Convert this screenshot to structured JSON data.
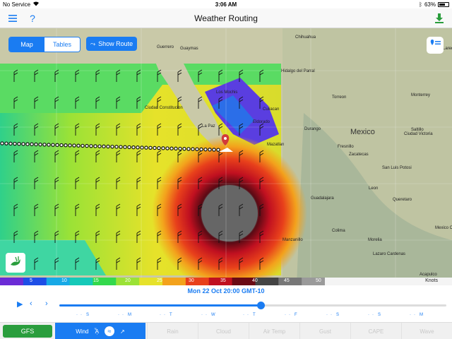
{
  "status_bar": {
    "carrier": "No Service",
    "time": "3:06 AM",
    "battery_label": "63%",
    "battery_level": 0.63
  },
  "nav": {
    "title": "Weather Routing",
    "menu_icon": "hamburger-icon",
    "help_label": "?",
    "download_icon": "download-icon"
  },
  "map": {
    "view_toggle": [
      {
        "label": "Map",
        "active": true
      },
      {
        "label": "Tables",
        "active": false
      }
    ],
    "show_route_label": "Show Route",
    "places": [
      {
        "name": "Chihuahua",
        "big": false
      },
      {
        "name": "Guerrero",
        "big": false
      },
      {
        "name": "Guaymas",
        "big": false
      },
      {
        "name": "Nuevo Laredo",
        "big": false
      },
      {
        "name": "Hidalgo del Parral",
        "big": false
      },
      {
        "name": "Monterrey",
        "big": false
      },
      {
        "name": "Torreon",
        "big": false
      },
      {
        "name": "Los Mochis",
        "big": false
      },
      {
        "name": "Ciudad Constitucion",
        "big": false
      },
      {
        "name": "Culiacan",
        "big": false
      },
      {
        "name": "La Paz",
        "big": false
      },
      {
        "name": "Eldorado",
        "big": false
      },
      {
        "name": "Durango",
        "big": false
      },
      {
        "name": "Mexico",
        "big": true
      },
      {
        "name": "Saltillo",
        "big": false
      },
      {
        "name": "Ciudad Victoria",
        "big": false
      },
      {
        "name": "Mazatlan",
        "big": false
      },
      {
        "name": "Fresnillo",
        "big": false
      },
      {
        "name": "Zacatecas",
        "big": false
      },
      {
        "name": "San Luis Potosi",
        "big": false
      },
      {
        "name": "Guadalajara",
        "big": false
      },
      {
        "name": "Leon",
        "big": false
      },
      {
        "name": "Queretaro",
        "big": false
      },
      {
        "name": "Manzanillo",
        "big": false
      },
      {
        "name": "Colima",
        "big": false
      },
      {
        "name": "Morelia",
        "big": false
      },
      {
        "name": "Mexico City",
        "big": false
      },
      {
        "name": "Lazaro Cardenas",
        "big": false
      },
      {
        "name": "Acapulco",
        "big": false
      }
    ]
  },
  "scale": {
    "ticks": [
      "5",
      "10",
      "15",
      "20",
      "25",
      "30",
      "35",
      "40",
      "45",
      "50"
    ],
    "unit": "Knots",
    "colors": [
      "#6b2bd6",
      "#1e4ee6",
      "#17a9e6",
      "#16c9b8",
      "#33d94c",
      "#9be236",
      "#e6e22a",
      "#f3a21c",
      "#e8401b",
      "#c01020",
      "#6a0a14",
      "#444",
      "#777",
      "#9a9a9a"
    ]
  },
  "timeline": {
    "date_label": "Mon 22 Oct 20:00 GMT-10",
    "progress": 0.52,
    "days": [
      "S",
      "M",
      "T",
      "W",
      "T",
      "F",
      "S",
      "S",
      "M"
    ]
  },
  "toolbar": {
    "model_label": "GFS",
    "tabs": [
      {
        "label": "Wind",
        "active": true
      },
      {
        "label": "Rain",
        "active": false
      },
      {
        "label": "Cloud",
        "active": false
      },
      {
        "label": "Air Temp",
        "active": false
      },
      {
        "label": "Gust",
        "active": false
      },
      {
        "label": "CAPE",
        "active": false
      },
      {
        "label": "Wave",
        "active": false
      }
    ]
  }
}
